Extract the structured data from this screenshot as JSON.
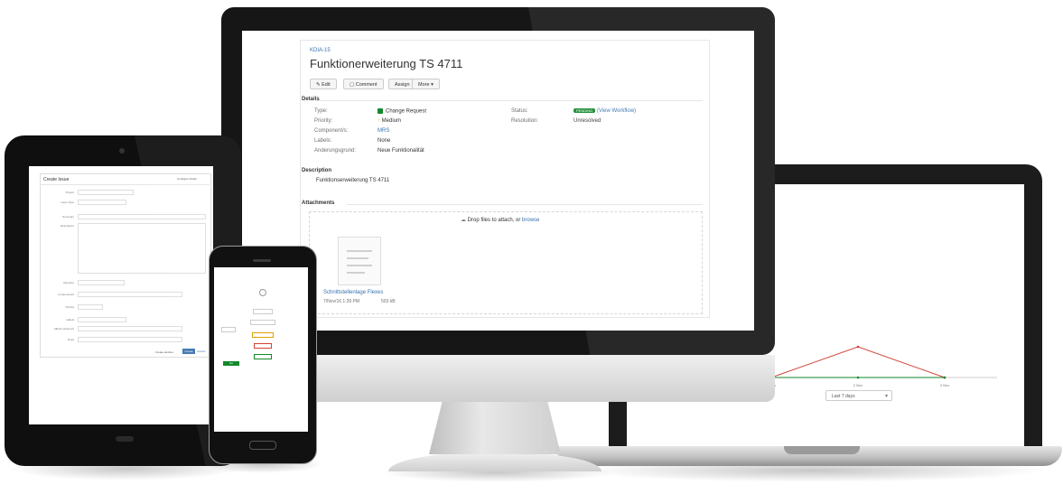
{
  "monitor": {
    "issue_key": "KDIA-15",
    "title": "Funktionerweiterung TS 4711",
    "buttons": {
      "edit": "Edit",
      "comment": "Comment",
      "assign": "Assign",
      "more": "More"
    },
    "details_heading": "Details",
    "details_left": [
      {
        "label": "Type:",
        "value": "Change Request"
      },
      {
        "label": "Priority:",
        "value": "Medium"
      },
      {
        "label": "Component/s:",
        "value": "MRS"
      },
      {
        "label": "Labels:",
        "value": "None"
      },
      {
        "label": "Anderungsgrund:",
        "value": "Neue Funktionalität"
      }
    ],
    "details_right": [
      {
        "label": "Status:",
        "badge": "PENDING",
        "value": "(View Workflow)"
      },
      {
        "label": "Resolution:",
        "value": "Unresolved"
      }
    ],
    "description_heading": "Description",
    "description_text": "Funktionserweiterung TS 4711",
    "attachments_heading": "Attachments",
    "drop_text": "Drop files to attach, or",
    "browse_text": "browse",
    "attachment_name": "Schnittstellenlage Flexes",
    "attachment_meta": "7/Nov/16 1:39 PM",
    "attachment_size": "503 kB",
    "colors": {
      "link": "#3572b0",
      "status_green": "#14892c",
      "priority_orange": "#f0a000"
    }
  },
  "laptop": {
    "chart_data": {
      "type": "line",
      "series": [
        {
          "values": [
            0,
            1,
            0
          ],
          "color": "#d04437"
        },
        {
          "values": [
            0,
            0,
            0
          ],
          "color": "#14892c"
        }
      ],
      "x": [
        "1 Nov",
        "2 Nov",
        "3 Nov"
      ],
      "grid": false
    },
    "select_value": "Last 7 days"
  },
  "tablet": {
    "form_title": "Create Issue",
    "configure_fields": "Configure Fields",
    "fields": [
      "Project",
      "Issue Type",
      "Summary",
      "Description",
      "Reporter",
      "Component/s",
      "Priority",
      "Labels",
      "Affects Version/s",
      "Fixes"
    ],
    "create_button": "Create",
    "cancel_link": "Cancel",
    "create_another": "Create another"
  },
  "phone": {
    "go_button": "Go"
  }
}
